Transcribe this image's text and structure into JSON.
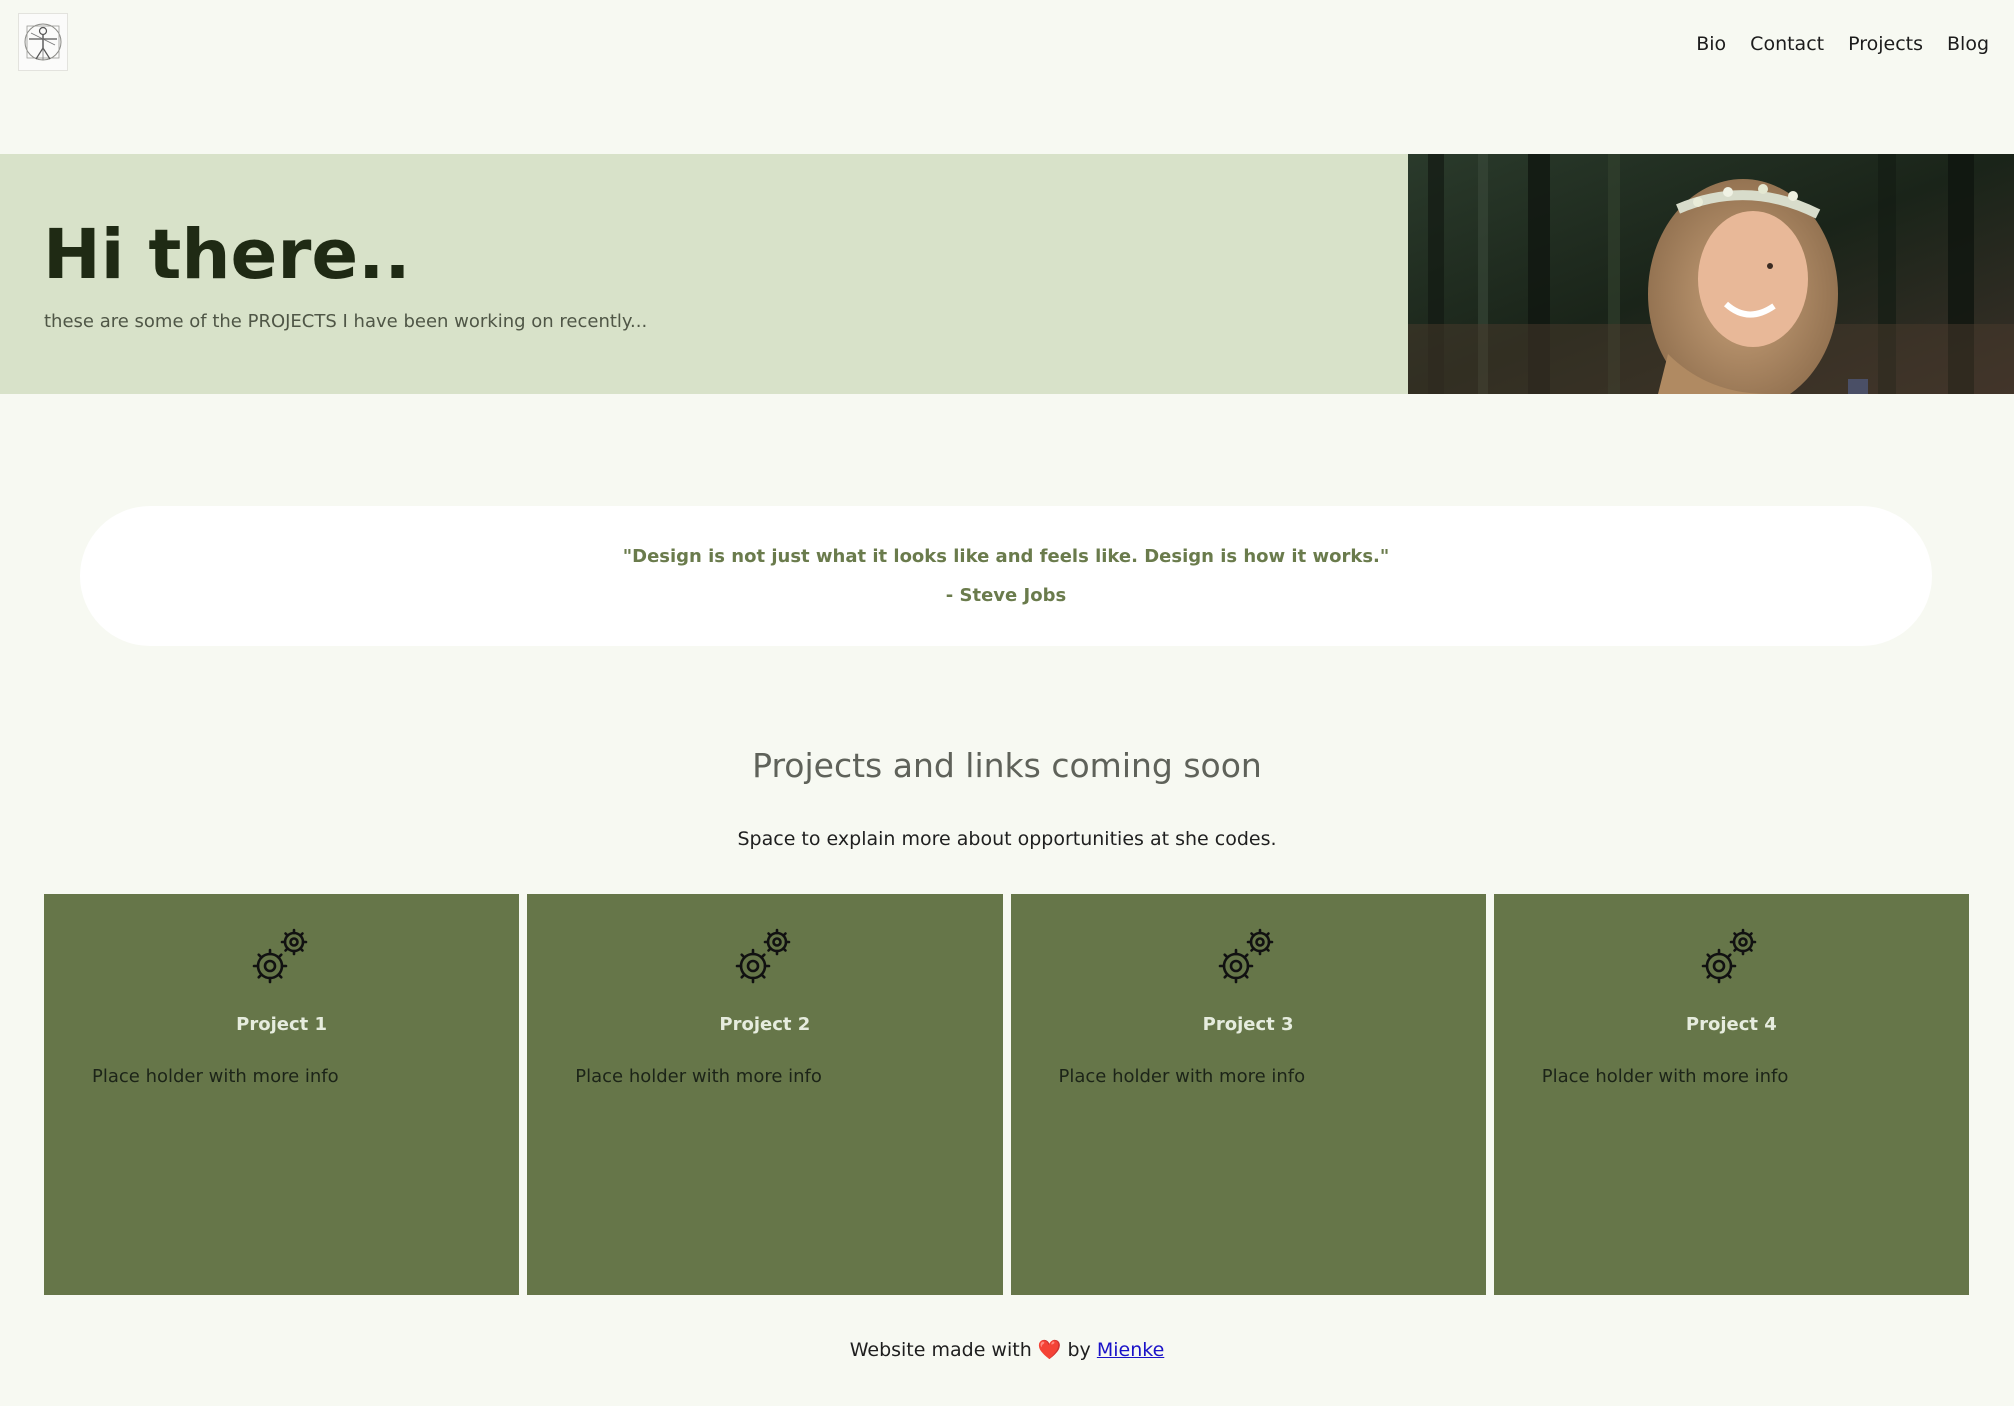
{
  "header": {
    "logo_icon": "vitruvian-man-logo",
    "nav": [
      "Bio",
      "Contact",
      "Projects",
      "Blog"
    ]
  },
  "hero": {
    "title": "Hi there..",
    "subtitle": "these are some of the PROJECTS I have been working on recently...",
    "photo": "smiling-woman-flower-crown-photo"
  },
  "quote": {
    "text": "\"Design is not just what it looks like and feels like. Design is how it works.\"",
    "author": "- Steve Jobs"
  },
  "projects_section": {
    "title": "Projects and links coming soon",
    "subtitle": "Space to explain more about opportunities at she codes."
  },
  "projects": [
    {
      "title": "Project 1",
      "text": "Place holder with more info",
      "icon": "gears-icon"
    },
    {
      "title": "Project 2",
      "text": "Place holder with more info",
      "icon": "gears-icon"
    },
    {
      "title": "Project 3",
      "text": "Place holder with more info",
      "icon": "gears-icon"
    },
    {
      "title": "Project 4",
      "text": "Place holder with more info",
      "icon": "gears-icon"
    }
  ],
  "footer": {
    "prefix": "Website made with",
    "heart": "❤️",
    "by": "by",
    "author_link": "Mienke"
  },
  "colors": {
    "background": "#f7f9f2",
    "hero_bg": "#d8e2c9",
    "card_bg": "#667649",
    "quote_text": "#6a7b4c"
  }
}
